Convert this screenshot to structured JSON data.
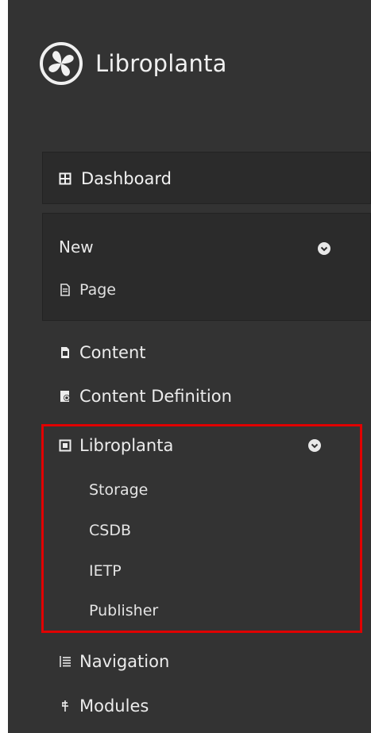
{
  "brand": {
    "name": "Libroplanta"
  },
  "dashboard": {
    "label": "Dashboard"
  },
  "new_menu": {
    "title": "New",
    "items": [
      {
        "label": "Page"
      }
    ]
  },
  "nav": {
    "content": "Content",
    "content_definition": "Content Definition",
    "libroplanta": "Libroplanta",
    "libroplanta_items": [
      {
        "label": "Storage"
      },
      {
        "label": "CSDB"
      },
      {
        "label": "IETP"
      },
      {
        "label": "Publisher"
      }
    ],
    "navigation": "Navigation",
    "modules": "Modules"
  },
  "colors": {
    "sidebar_bg": "#333333",
    "box_bg": "#2b2b2b",
    "highlight_border": "#e00000",
    "text": "#e8e8e8"
  },
  "icons": {
    "brand": "libroplanta-logo-icon",
    "dashboard": "dashboard-grid-icon",
    "page": "page-icon",
    "content": "content-icon",
    "content_definition": "content-definition-icon",
    "libroplanta": "libroplanta-square-icon",
    "navigation": "navigation-list-icon",
    "modules": "modules-plug-icon",
    "expand": "chevron-down-icon"
  }
}
